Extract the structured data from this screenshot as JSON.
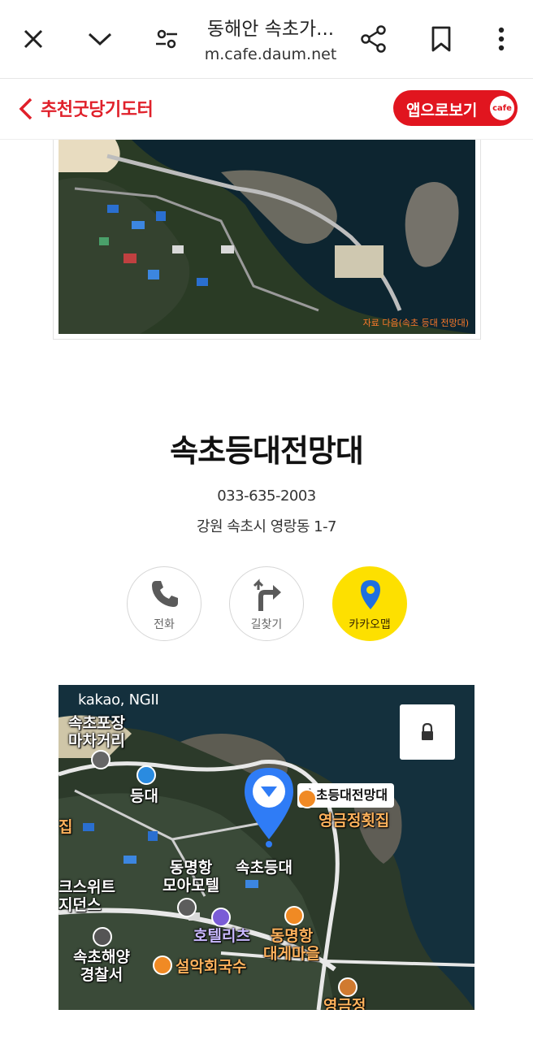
{
  "browser": {
    "title": "동해안 속초가...",
    "url": "m.cafe.daum.net"
  },
  "cafe": {
    "name": "추천굿당기도터",
    "app_button_label": "앱으로보기",
    "app_badge": "cafe"
  },
  "photo": {
    "caption": "자료 다음(속초 등대 전망대)"
  },
  "place": {
    "name": "속초등대전망대",
    "phone": "033-635-2003",
    "address": "강원 속초시 영랑동 1-7",
    "actions": [
      {
        "label": "전화",
        "icon": "phone-icon"
      },
      {
        "label": "길찾기",
        "icon": "directions-icon"
      },
      {
        "label": "카카오맵",
        "icon": "map-pin-icon"
      }
    ]
  },
  "map": {
    "logo": "kakao, NGII",
    "pin_label": "속초등대전망대",
    "labels": {
      "pocha": "속초포장\n마차거리",
      "deungdae": "등대",
      "sokcho_deungdae": "속초등대",
      "motel": "동명항\n모아모텔",
      "jip": "집",
      "suite": "크스위트\n지던스",
      "hotel": "호텔리츠",
      "dongmyeong": "동명항\n대게마을",
      "police": "속초해양\n경찰서",
      "noodle": "설악회국수",
      "restaurant": "영금정횟집",
      "bottom": "영금정"
    }
  },
  "colors": {
    "brand_red": "#e1151f",
    "kakao_yellow": "#fde000",
    "pin_blue": "#2f7cf6"
  }
}
